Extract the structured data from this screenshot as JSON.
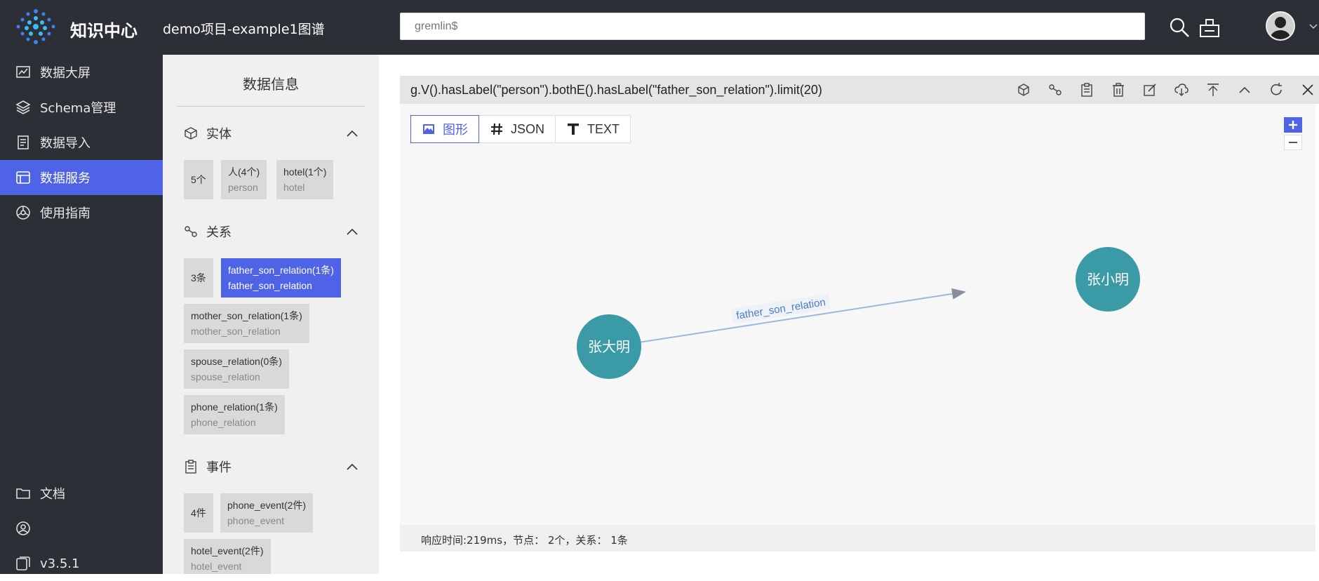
{
  "header": {
    "brand": "知识中心",
    "project": "demo项目-example1图谱",
    "search_placeholder": "gremlin$"
  },
  "sidebar": {
    "items": [
      {
        "label": "数据大屏",
        "icon": "chart-screen-icon"
      },
      {
        "label": "Schema管理",
        "icon": "layers-icon"
      },
      {
        "label": "数据导入",
        "icon": "import-icon"
      },
      {
        "label": "数据服务",
        "icon": "service-icon",
        "active": true
      },
      {
        "label": "使用指南",
        "icon": "guide-icon"
      }
    ],
    "bottom": [
      {
        "label": "文档",
        "icon": "folder-icon"
      },
      {
        "label": "",
        "icon": "user-circle-icon"
      },
      {
        "label": "v3.5.1",
        "icon": "version-icon"
      }
    ]
  },
  "info": {
    "title": "数据信息",
    "entities": {
      "label": "实体",
      "count": "5个",
      "chips": [
        {
          "name": "人(4个)",
          "sub": "person"
        },
        {
          "name": "hotel(1个)",
          "sub": "hotel"
        }
      ]
    },
    "relations": {
      "label": "关系",
      "count": "3条",
      "chips": [
        {
          "name": "father_son_relation(1条)",
          "sub": "father_son_relation",
          "active": true
        },
        {
          "name": "mother_son_relation(1条)",
          "sub": "mother_son_relation"
        },
        {
          "name": "spouse_relation(0条)",
          "sub": "spouse_relation"
        },
        {
          "name": "phone_relation(1条)",
          "sub": "phone_relation"
        }
      ]
    },
    "events": {
      "label": "事件",
      "count": "4件",
      "chips": [
        {
          "name": "phone_event(2件)",
          "sub": "phone_event"
        },
        {
          "name": "hotel_event(2件)",
          "sub": "hotel_event"
        }
      ]
    }
  },
  "query": {
    "text": "g.V().hasLabel(\"person\").bothE().hasLabel(\"father_son_relation\").limit(20)"
  },
  "tabs": [
    {
      "label": "图形",
      "icon": "image-icon",
      "active": true
    },
    {
      "label": "JSON",
      "icon": "hash-icon"
    },
    {
      "label": "TEXT",
      "icon": "text-t-icon"
    }
  ],
  "graph": {
    "nodes": [
      {
        "id": "a",
        "label": "张大明"
      },
      {
        "id": "b",
        "label": "张小明"
      }
    ],
    "edges": [
      {
        "from": "a",
        "to": "b",
        "label": "father_son_relation"
      }
    ],
    "node_color": "#3a9aa6",
    "edge_color": "#9bb7e0",
    "edge_label_color": "#4f7cc7"
  },
  "status": {
    "text": "响应时间:219ms，节点： 2个，关系： 1条"
  },
  "colors": {
    "topbar": "#2d2f36",
    "accent": "#4f63e6",
    "panel": "#f0f0f0"
  }
}
